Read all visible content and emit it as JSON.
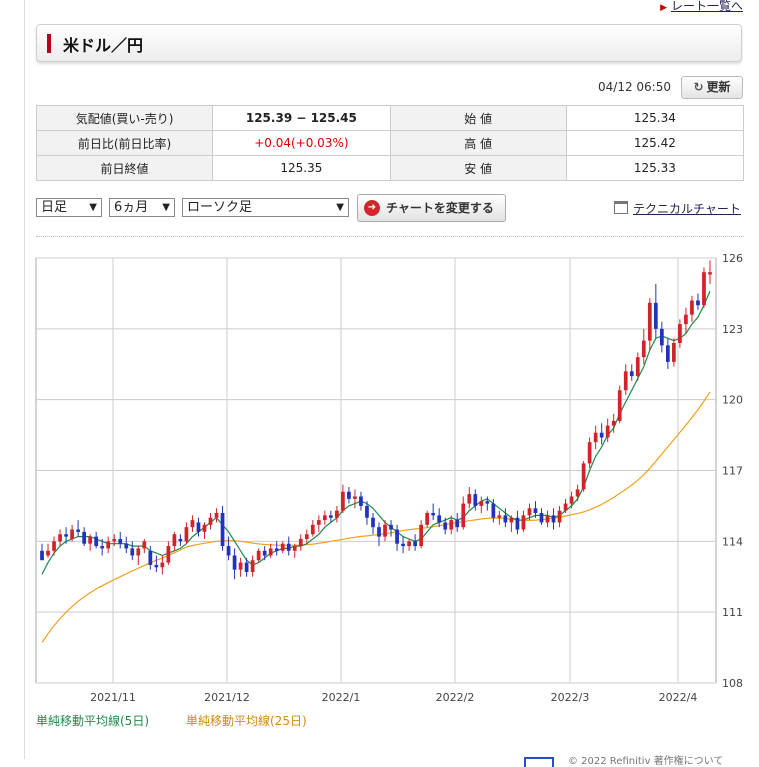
{
  "header": {
    "rate_list_link": "レート一覧へ",
    "pair_title": "米ドル／円"
  },
  "quote": {
    "time": "04/12 06:50",
    "refresh_label": "更新",
    "rows": [
      {
        "l1": "気配値(買い-売り)",
        "v1": "125.39 − 125.45",
        "l2": "始 値",
        "v2": "125.34"
      },
      {
        "l1": "前日比(前日比率)",
        "v1": "+0.04(+0.03%)",
        "l2": "高 値",
        "v2": "125.42"
      },
      {
        "l1": "前日終値",
        "v1": "125.35",
        "l2": "安 値",
        "v2": "125.33"
      }
    ]
  },
  "controls": {
    "interval": "日足",
    "period": "6ヵ月",
    "chart_kind": "ローソク足",
    "change_button": "チャートを変更する",
    "technical_link": "テクニカルチャート"
  },
  "legend": {
    "ma5": "単純移動平均線(5日)",
    "ma25": "単純移動平均線(25日)"
  },
  "footer": {
    "text": "© 2022 Refinitiv 著作権について"
  },
  "colors": {
    "up": "#d2232a",
    "down": "#2233bb",
    "ma5": "#1e8a4a",
    "ma25": "#eea21f",
    "grid": "#cccccc"
  },
  "chart_data": {
    "type": "candlestick",
    "x_labels": [
      "2021/11",
      "2021/12",
      "2022/1",
      "2022/2",
      "2022/3",
      "2022/4"
    ],
    "y_ticks": [
      108,
      111,
      114,
      117,
      120,
      123,
      126
    ],
    "ylim": [
      108,
      126
    ],
    "candles": [
      [
        113.6,
        113.9,
        113.3,
        113.2
      ],
      [
        113.4,
        113.9,
        113.3,
        113.6
      ],
      [
        113.6,
        114.2,
        113.4,
        114.0
      ],
      [
        114.0,
        114.5,
        113.8,
        114.3
      ],
      [
        114.3,
        114.6,
        113.9,
        114.2
      ],
      [
        114.1,
        114.7,
        114.0,
        114.5
      ],
      [
        114.5,
        114.9,
        114.2,
        114.4
      ],
      [
        114.4,
        114.6,
        113.8,
        113.9
      ],
      [
        113.9,
        114.3,
        113.6,
        114.2
      ],
      [
        114.2,
        114.4,
        113.7,
        113.8
      ],
      [
        113.8,
        114.1,
        113.4,
        113.7
      ],
      [
        113.7,
        114.2,
        113.5,
        114.0
      ],
      [
        114.0,
        114.3,
        113.8,
        114.1
      ],
      [
        114.1,
        114.4,
        113.7,
        113.9
      ],
      [
        113.9,
        114.2,
        113.5,
        113.7
      ],
      [
        113.7,
        114.0,
        113.2,
        113.4
      ],
      [
        113.4,
        113.8,
        113.0,
        113.7
      ],
      [
        113.7,
        114.1,
        113.5,
        114.0
      ],
      [
        113.6,
        113.8,
        112.8,
        113.0
      ],
      [
        113.0,
        113.4,
        112.7,
        112.9
      ],
      [
        112.9,
        113.4,
        112.6,
        113.1
      ],
      [
        113.1,
        114.0,
        113.0,
        113.8
      ],
      [
        113.8,
        114.4,
        113.6,
        114.3
      ],
      [
        114.1,
        114.3,
        113.8,
        114.0
      ],
      [
        114.0,
        114.8,
        113.9,
        114.6
      ],
      [
        114.6,
        115.1,
        114.4,
        114.9
      ],
      [
        114.8,
        115.0,
        114.2,
        114.4
      ],
      [
        114.4,
        114.8,
        114.1,
        114.7
      ],
      [
        114.7,
        115.2,
        114.5,
        115.0
      ],
      [
        115.0,
        115.4,
        114.8,
        115.2
      ],
      [
        115.2,
        115.5,
        113.6,
        113.8
      ],
      [
        113.8,
        114.2,
        113.2,
        113.4
      ],
      [
        113.4,
        113.7,
        112.4,
        112.8
      ],
      [
        112.8,
        113.3,
        112.5,
        113.1
      ],
      [
        113.1,
        113.3,
        112.5,
        112.7
      ],
      [
        112.7,
        113.4,
        112.5,
        113.2
      ],
      [
        113.2,
        113.7,
        113.1,
        113.6
      ],
      [
        113.6,
        113.8,
        113.2,
        113.4
      ],
      [
        113.4,
        113.9,
        113.3,
        113.7
      ],
      [
        113.7,
        114.0,
        113.4,
        113.6
      ],
      [
        113.6,
        114.0,
        113.5,
        113.9
      ],
      [
        113.9,
        114.2,
        113.4,
        113.6
      ],
      [
        113.6,
        113.9,
        113.3,
        113.8
      ],
      [
        113.8,
        114.3,
        113.6,
        114.1
      ],
      [
        114.1,
        114.5,
        113.9,
        114.3
      ],
      [
        114.3,
        114.9,
        114.2,
        114.7
      ],
      [
        114.7,
        115.1,
        114.4,
        114.9
      ],
      [
        114.9,
        115.3,
        114.7,
        115.1
      ],
      [
        115.1,
        115.3,
        114.8,
        115.0
      ],
      [
        115.0,
        115.5,
        114.8,
        115.3
      ],
      [
        115.3,
        116.4,
        115.2,
        116.1
      ],
      [
        116.1,
        116.3,
        115.6,
        115.8
      ],
      [
        115.8,
        116.2,
        115.4,
        115.9
      ],
      [
        115.9,
        116.1,
        115.3,
        115.5
      ],
      [
        115.5,
        115.7,
        114.7,
        115.0
      ],
      [
        115.0,
        115.2,
        114.3,
        114.6
      ],
      [
        114.6,
        114.8,
        113.8,
        114.2
      ],
      [
        114.2,
        114.9,
        114.0,
        114.7
      ],
      [
        114.7,
        114.9,
        114.2,
        114.5
      ],
      [
        114.5,
        114.7,
        113.6,
        113.9
      ],
      [
        113.9,
        114.2,
        113.5,
        113.8
      ],
      [
        113.8,
        114.1,
        113.6,
        114.0
      ],
      [
        114.0,
        114.3,
        113.6,
        113.8
      ],
      [
        113.8,
        114.9,
        113.7,
        114.7
      ],
      [
        114.7,
        115.3,
        114.6,
        115.2
      ],
      [
        115.2,
        115.6,
        114.9,
        115.1
      ],
      [
        115.1,
        115.4,
        114.6,
        114.8
      ],
      [
        114.8,
        115.0,
        114.3,
        114.5
      ],
      [
        114.5,
        115.1,
        114.3,
        114.9
      ],
      [
        114.9,
        115.2,
        114.4,
        114.6
      ],
      [
        114.6,
        115.9,
        114.5,
        115.6
      ],
      [
        115.6,
        116.3,
        115.4,
        116.0
      ],
      [
        116.0,
        116.2,
        115.3,
        115.5
      ],
      [
        115.5,
        115.9,
        115.2,
        115.7
      ],
      [
        115.7,
        115.9,
        115.3,
        115.6
      ],
      [
        115.6,
        115.8,
        114.8,
        115.0
      ],
      [
        115.0,
        115.3,
        114.7,
        115.1
      ],
      [
        115.1,
        115.4,
        114.6,
        114.8
      ],
      [
        114.8,
        115.1,
        114.4,
        115.0
      ],
      [
        115.0,
        115.3,
        114.3,
        114.5
      ],
      [
        114.5,
        115.3,
        114.4,
        115.1
      ],
      [
        115.1,
        115.6,
        114.9,
        115.4
      ],
      [
        115.4,
        115.7,
        115.0,
        115.2
      ],
      [
        115.2,
        115.4,
        114.7,
        114.8
      ],
      [
        114.8,
        115.3,
        114.6,
        115.1
      ],
      [
        115.1,
        115.4,
        114.5,
        114.8
      ],
      [
        114.8,
        115.5,
        114.6,
        115.3
      ],
      [
        115.3,
        115.8,
        115.2,
        115.6
      ],
      [
        115.6,
        116.1,
        115.4,
        115.9
      ],
      [
        115.9,
        116.4,
        115.7,
        116.2
      ],
      [
        116.2,
        117.4,
        116.1,
        117.3
      ],
      [
        117.3,
        118.4,
        117.1,
        118.2
      ],
      [
        118.2,
        118.9,
        117.9,
        118.6
      ],
      [
        118.6,
        119.0,
        118.1,
        118.4
      ],
      [
        118.4,
        119.2,
        118.2,
        118.9
      ],
      [
        118.9,
        119.4,
        118.6,
        119.1
      ],
      [
        119.1,
        120.6,
        119.0,
        120.4
      ],
      [
        120.4,
        121.5,
        120.2,
        121.2
      ],
      [
        121.2,
        121.5,
        120.8,
        121.0
      ],
      [
        121.0,
        122.0,
        120.8,
        121.8
      ],
      [
        121.8,
        123.0,
        121.5,
        122.5
      ],
      [
        122.5,
        124.3,
        122.1,
        124.1
      ],
      [
        124.1,
        124.9,
        122.6,
        123.0
      ],
      [
        123.0,
        123.3,
        122.0,
        122.3
      ],
      [
        122.3,
        122.6,
        121.3,
        121.6
      ],
      [
        121.6,
        122.6,
        121.4,
        122.4
      ],
      [
        122.4,
        123.4,
        122.2,
        123.2
      ],
      [
        123.2,
        123.9,
        122.8,
        123.6
      ],
      [
        123.6,
        124.4,
        123.3,
        124.2
      ],
      [
        124.2,
        124.5,
        123.8,
        124.0
      ],
      [
        124.0,
        125.6,
        123.9,
        125.4
      ],
      [
        125.3,
        125.9,
        124.9,
        125.4
      ]
    ],
    "ma5": [
      112.6,
      113.1,
      113.5,
      113.8,
      114.0,
      114.1,
      114.2,
      114.2,
      114.2,
      114.1,
      114.0,
      113.9,
      113.9,
      113.9,
      113.9,
      113.8,
      113.8,
      113.8,
      113.6,
      113.5,
      113.4,
      113.5,
      113.6,
      113.7,
      113.9,
      114.2,
      114.4,
      114.6,
      114.8,
      115.0,
      114.7,
      114.4,
      114.0,
      113.6,
      113.2,
      113.0,
      113.1,
      113.3,
      113.5,
      113.6,
      113.7,
      113.7,
      113.8,
      113.8,
      113.9,
      114.1,
      114.3,
      114.6,
      114.8,
      115.0,
      115.3,
      115.5,
      115.6,
      115.7,
      115.6,
      115.4,
      115.1,
      114.8,
      114.6,
      114.4,
      114.2,
      114.1,
      114.0,
      114.1,
      114.4,
      114.7,
      114.8,
      114.9,
      115.0,
      114.9,
      115.0,
      115.3,
      115.5,
      115.7,
      115.8,
      115.6,
      115.4,
      115.2,
      115.0,
      114.9,
      114.9,
      115.0,
      115.1,
      115.1,
      115.1,
      115.0,
      115.1,
      115.3,
      115.5,
      115.8,
      116.3,
      117.0,
      117.6,
      118.0,
      118.5,
      118.8,
      119.4,
      119.9,
      120.4,
      120.9,
      121.4,
      122.1,
      122.6,
      122.7,
      122.6,
      122.5,
      122.6,
      122.8,
      123.2,
      123.5,
      124.0,
      124.6
    ]
  }
}
